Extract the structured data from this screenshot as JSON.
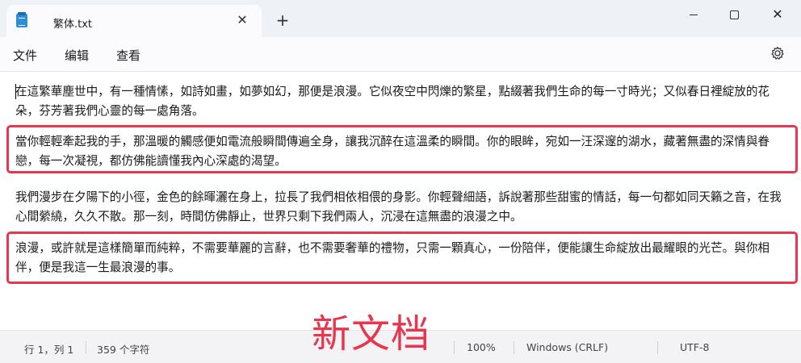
{
  "window": {
    "tab_title": "繁体.txt",
    "tab_close": "✕",
    "new_tab": "+",
    "close": "✕"
  },
  "menu": {
    "items": [
      "文件",
      "编辑",
      "查看"
    ],
    "settings_icon": "gear-icon"
  },
  "document": {
    "paragraphs": [
      "在這繁華塵世中，有一種情愫，如詩如畫，如夢如幻，那便是浪漫。它似夜空中閃爍的繁星，點綴著我們生命的每一寸時光；又似春日裡綻放的花朵，芬芳著我們心靈的每一處角落。",
      "當你輕輕牽起我的手，那溫暖的觸感便如電流般瞬間傳遍全身，讓我沉醉在這溫柔的瞬間。你的眼眸，宛如一汪深邃的湖水，藏著無盡的深情與眷戀，每一次凝視，都仿佛能讀懂我內心深處的渴望。",
      "我們漫步在夕陽下的小徑，金色的餘暉灑在身上，拉長了我們相依相偎的身影。你輕聲細語，訴說著那些甜蜜的情話，每一句都如同天籟之音，在我心間縈繞，久久不散。那一刻，時間仿佛靜止，世界只剩下我們兩人，沉浸在這無盡的浪漫之中。",
      "浪漫，或許就是這樣簡單而純粹，不需要華麗的言辭，也不需要奢華的禮物，只需一顆真心，一份陪伴，便能讓生命綻放出最耀眼的光芒。與你相伴，便是我這一生最浪漫的事。"
    ],
    "highlight_color": "#e8364f"
  },
  "status": {
    "position": "行 1，列 1",
    "char_count": "359 个字符",
    "zoom": "100%",
    "line_ending": "Windows (CRLF)",
    "encoding": "UTF-8"
  },
  "overlay": {
    "watermark_text": "新文档",
    "color": "#e8364f"
  }
}
